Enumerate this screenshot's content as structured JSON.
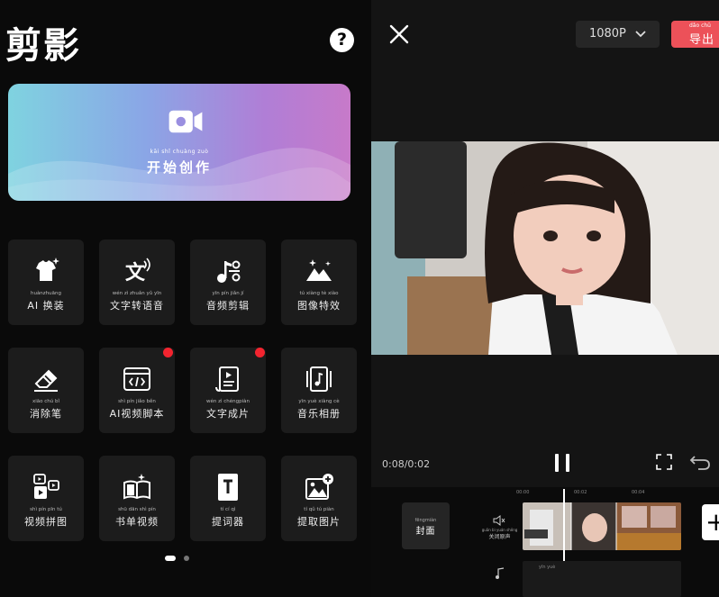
{
  "app": {
    "logo": "剪影",
    "help_icon": "question-bubble-icon"
  },
  "create": {
    "pinyin": "kāi shǐ chuàng zuò",
    "label": "开始创作",
    "icon": "video-camera-icon"
  },
  "tools": [
    {
      "pinyin": "huànzhuāng",
      "label": "AI 换装",
      "icon": "tshirt-sparkle-icon",
      "badge": false
    },
    {
      "pinyin": "wén zì zhuǎn yǔ yīn",
      "label": "文字转语音",
      "icon": "text-to-speech-icon",
      "badge": false
    },
    {
      "pinyin": "yīn pín jiǎn jí",
      "label": "音频剪辑",
      "icon": "music-scissors-icon",
      "badge": false
    },
    {
      "pinyin": "tú xiàng tè xiào",
      "label": "图像特效",
      "icon": "mountain-sparkle-icon",
      "badge": false
    },
    {
      "pinyin": "xiāo chú bǐ",
      "label": "消除笔",
      "icon": "eraser-icon",
      "badge": false
    },
    {
      "pinyin": "shì pín jiǎo běn",
      "label": "AI视频脚本",
      "icon": "code-window-icon",
      "badge": true
    },
    {
      "pinyin": "wén zì chéngpiàn",
      "label": "文字成片",
      "icon": "script-scroll-icon",
      "badge": true
    },
    {
      "pinyin": "yīn yuè xiàng cè",
      "label": "音乐相册",
      "icon": "music-album-icon",
      "badge": false
    },
    {
      "pinyin": "shì pín pīn tú",
      "label": "视频拼图",
      "icon": "video-collage-icon",
      "badge": false
    },
    {
      "pinyin": "shū dān shì pín",
      "label": "书单视频",
      "icon": "open-book-icon",
      "badge": false
    },
    {
      "pinyin": "tí cí qì",
      "label": "提词器",
      "icon": "teleprompter-icon",
      "badge": false
    },
    {
      "pinyin": "tí qǔ tú piàn",
      "label": "提取图片",
      "icon": "image-add-icon",
      "badge": false
    }
  ],
  "pager": {
    "pages": 2,
    "current": 1
  },
  "editor": {
    "resolution": "1080P",
    "export_pinyin": "dǎo chū",
    "export_label": "导出",
    "time": "0:08/0:02",
    "cover_pinyin": "fēngmiàn",
    "cover_label": "封面",
    "mute_pinyin": "guān bì yuán shēng",
    "mute_label": "关闭原声",
    "ticks": [
      "00:00",
      "00:02",
      "00:04"
    ],
    "add_label": "+",
    "second_track_pinyin": "yīn yuè",
    "accent": "#ec5159",
    "badge_color": "#f2242f"
  }
}
